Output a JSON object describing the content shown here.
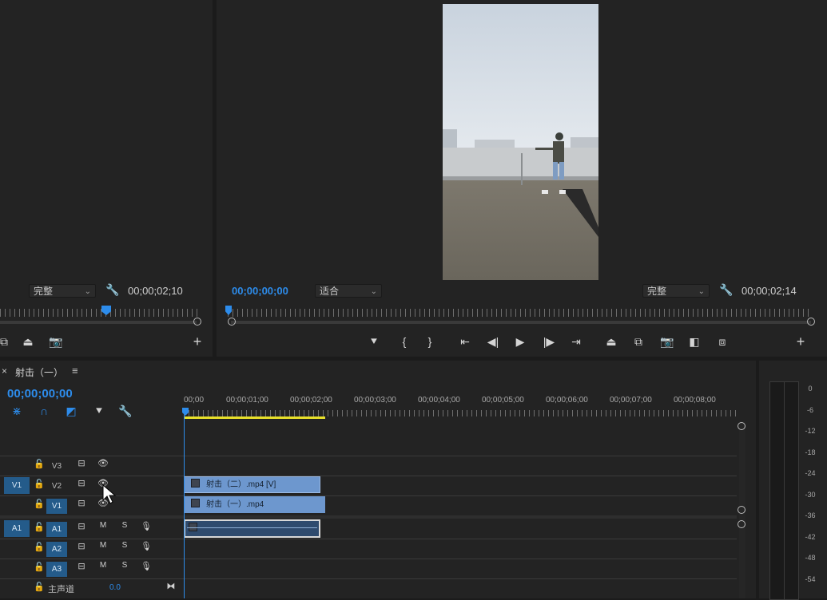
{
  "source_monitor": {
    "quality": "完整",
    "timecode": "00;00;02;10"
  },
  "program_monitor": {
    "playhead_timecode": "00;00;00;00",
    "zoom": "适合",
    "quality": "完整",
    "duration_timecode": "00;00;02;14"
  },
  "timeline": {
    "sequence_name": "射击（一）",
    "playhead_timecode": "00;00;00;00",
    "ruler_labels": [
      "00;00",
      "00;00;01;00",
      "00;00;02;00",
      "00;00;03;00",
      "00;00;04;00",
      "00;00;05;00",
      "00;00;06;00",
      "00;00;07;00",
      "00;00;08;00"
    ],
    "tracks": {
      "v3": "V3",
      "v2": "V2",
      "v1": "V1",
      "a1": "A1",
      "a2": "A2",
      "a3": "A3",
      "source_v": "V1",
      "source_a": "A1",
      "mute": "M",
      "solo": "S",
      "master_label": "主声道",
      "master_value": "0.0"
    },
    "clips": {
      "v2_clip": "射击（二）.mp4 [V]",
      "v1_clip": "射击（一）.mp4"
    }
  },
  "audio_meter": {
    "labels": [
      "0",
      "-6",
      "-12",
      "-18",
      "-24",
      "-30",
      "-36",
      "-42",
      "-48",
      "-54"
    ]
  },
  "colors": {
    "accent": "#2d8ceb",
    "track_active": "#245b8a",
    "clip": "#6d97ce",
    "audio_clip": "#2f4b6e",
    "work_area": "#e8e02a"
  }
}
